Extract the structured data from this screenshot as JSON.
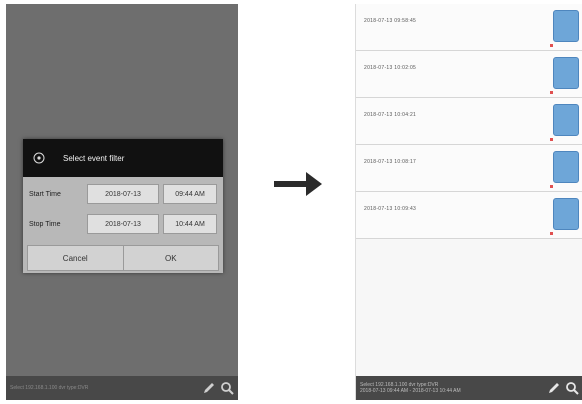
{
  "left_screen": {
    "dialog": {
      "title": "Select event filter",
      "start_label": "Start Time",
      "start_date": "2018-07-13",
      "start_time": "09:44 AM",
      "stop_label": "Stop Time",
      "stop_date": "2018-07-13",
      "stop_time": "10:44 AM",
      "cancel_label": "Cancel",
      "ok_label": "OK"
    },
    "status_text": "Select 192.168.1.100 dvr type:DVR"
  },
  "arrow_icon": "right-arrow-icon",
  "right_screen": {
    "events": [
      {
        "timestamp": "2018-07-13 09:58:45"
      },
      {
        "timestamp": "2018-07-13 10:02:05"
      },
      {
        "timestamp": "2018-07-13 10:04:21"
      },
      {
        "timestamp": "2018-07-13 10:08:17"
      },
      {
        "timestamp": "2018-07-13 10:09:43"
      }
    ],
    "status_line1": "Select 192.168.1.100 dvr type:DVR",
    "status_line2": "2018-07-13 09:44 AM - 2018-07-13 10:44 AM"
  },
  "colors": {
    "dialog_header": "#111111",
    "dim_background": "#6e6e6e",
    "thumbnail": "#6ea6d8",
    "bottom_bar": "#484848"
  }
}
